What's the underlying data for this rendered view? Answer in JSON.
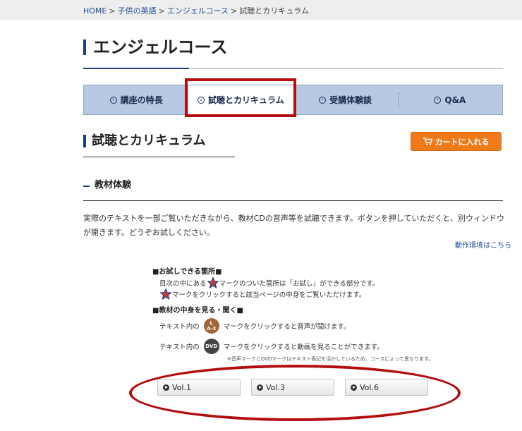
{
  "breadcrumb": {
    "home": "HOME",
    "sep": ">",
    "level1": "子供の英語",
    "level2": "エンジェルコース",
    "current": "試聴とカリキュラム"
  },
  "page": {
    "title": "エンジェルコース"
  },
  "tabs": [
    {
      "label": "講座の特長",
      "icon": "circle-arrow-right-icon"
    },
    {
      "label": "試聴とカリキュラム",
      "icon": "circle-arrow-down-icon",
      "active": true
    },
    {
      "label": "受講体験談",
      "icon": "circle-arrow-right-icon"
    },
    {
      "label": "Q&A",
      "icon": "circle-arrow-right-icon"
    }
  ],
  "section": {
    "title": "試聴とカリキュラム"
  },
  "cart": {
    "label": "カートに入れる",
    "icon": "cart-icon"
  },
  "subsection": {
    "title": "教材体験"
  },
  "intro": {
    "text": "実際のテキストを一部ご覧いただきながら、教材CDの音声等を試聴できます。ボタンを押していただくと、別ウィンドウが開きます。どうぞお試しください。",
    "env_link": "動作環境はこちら"
  },
  "guide": {
    "head1": "■お試しできる箇所■",
    "line1_pre": "目次の中にある",
    "line1_post": "マークのついた箇所は「お試し」ができる部分です。",
    "line2_post": "マークをクリックすると該当ページの中身をご覧いただけます。",
    "head2": "■教材の中身を見る・聞く■",
    "line3_pre": "テキスト内の",
    "line3_badge_top": "L",
    "line3_badge_bottom": "A-3",
    "line3_post": "マークをクリックすると音声が聞けます。",
    "line4_pre": "テキスト内の",
    "line4_badge": "DVD",
    "line4_post": "マークをクリックすると動画を見ることができます。",
    "note": "※音声マークとDVDマークはテキスト表記を活かしているため、コースによって異なります。"
  },
  "volumes": [
    {
      "label": "Vol.1"
    },
    {
      "label": "Vol.3"
    },
    {
      "label": "Vol.6"
    }
  ],
  "colors": {
    "accent_navy": "#1b3f82",
    "tab_bg": "#b8c9e3",
    "cart_orange": "#ee7a1a",
    "highlight_red": "#b30d0d"
  }
}
